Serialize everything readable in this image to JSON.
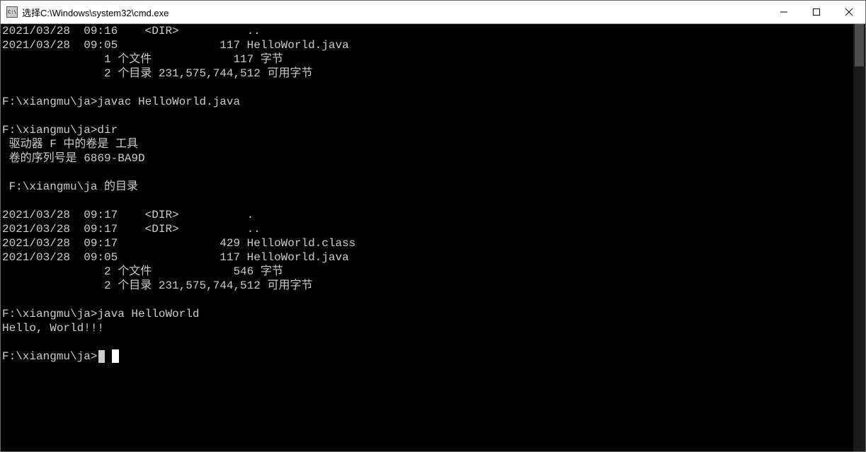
{
  "window": {
    "title": "选择C:\\Windows\\system32\\cmd.exe"
  },
  "terminal": {
    "prev_dir_tail": [
      "2021/03/28  09:16    <DIR>          ..",
      "2021/03/28  09:05               117 HelloWorld.java",
      "               1 个文件            117 字节",
      "               2 个目录 231,575,744,512 可用字节"
    ],
    "blank1": "",
    "prompt1": "F:\\xiangmu\\ja>javac HelloWorld.java",
    "blank2": "",
    "prompt2": "F:\\xiangmu\\ja>dir",
    "vol_line": " 驱动器 F 中的卷是 工具",
    "serial_line": " 卷的序列号是 6869-BA9D",
    "blank3": "",
    "dir_of_line": " F:\\xiangmu\\ja 的目录",
    "blank4": "",
    "entry1": "2021/03/28  09:17    <DIR>          .",
    "entry2": "2021/03/28  09:17    <DIR>          ..",
    "entry3": "2021/03/28  09:17               429 HelloWorld.class",
    "entry4": "2021/03/28  09:05               117 HelloWorld.java",
    "summary_files": "               2 个文件            546 字节",
    "summary_dirs": "               2 个目录 231,575,744,512 可用字节",
    "blank5": "",
    "prompt3": "F:\\xiangmu\\ja>java HelloWorld",
    "output_line": "Hello, World!!!",
    "blank6": "",
    "current_prompt": "F:\\xiangmu\\ja>"
  }
}
